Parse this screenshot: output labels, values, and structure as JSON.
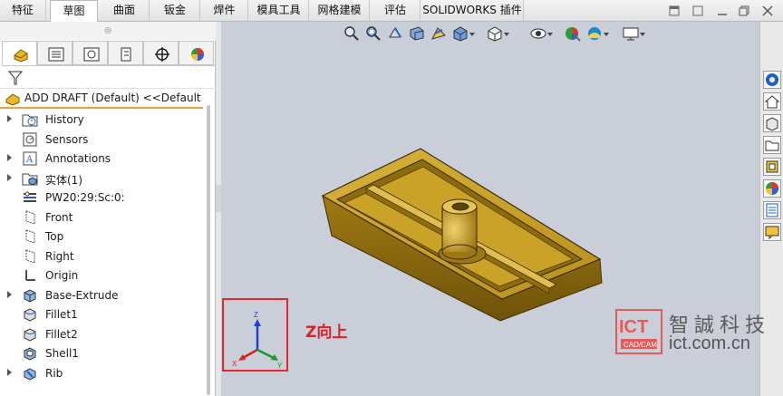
{
  "tabs": [
    "特征",
    "草图",
    "曲面",
    "钣金",
    "焊件",
    "模具工具",
    "网格建模",
    "评估",
    "SOLIDWORKS 插件"
  ],
  "active_tab": "草图",
  "panel_grip": "◎",
  "feature_tree": {
    "root": "ADD DRAFT (Default) <<Default>_",
    "items": [
      {
        "label": "History",
        "icon": "history-folder-icon",
        "expandable": true
      },
      {
        "label": "Sensors",
        "icon": "sensor-icon",
        "expandable": false
      },
      {
        "label": "Annotations",
        "icon": "annotation-icon",
        "expandable": true
      },
      {
        "label": "实体(1)",
        "icon": "solid-bodies-folder-icon",
        "expandable": true
      },
      {
        "label": "PW20:29:Sc:0:",
        "icon": "material-icon",
        "expandable": false
      },
      {
        "label": "Front",
        "icon": "plane-icon",
        "expandable": false
      },
      {
        "label": "Top",
        "icon": "plane-icon",
        "expandable": false
      },
      {
        "label": "Right",
        "icon": "plane-icon",
        "expandable": false
      },
      {
        "label": "Origin",
        "icon": "origin-icon",
        "expandable": false
      },
      {
        "label": "Base-Extrude",
        "icon": "extrude-icon",
        "expandable": true
      },
      {
        "label": "Fillet1",
        "icon": "fillet-icon",
        "expandable": false
      },
      {
        "label": "Fillet2",
        "icon": "fillet-icon",
        "expandable": false
      },
      {
        "label": "Shell1",
        "icon": "shell-icon",
        "expandable": false
      },
      {
        "label": "Rib",
        "icon": "rib-icon",
        "expandable": true
      }
    ]
  },
  "annotation": {
    "label": "Z向上"
  },
  "triad": {
    "z": "Z",
    "x": "X",
    "y": "Y"
  },
  "watermark": {
    "logo_text": "ICT",
    "logo_sub": "CAD/CAM",
    "chinese": "智誠科技",
    "url": "ict.com.cn"
  },
  "colors": {
    "part": "#c9a227",
    "viewport": "#c9ced8",
    "annotation_red": "#e8262c",
    "selection_orange": "#e8a33a"
  }
}
